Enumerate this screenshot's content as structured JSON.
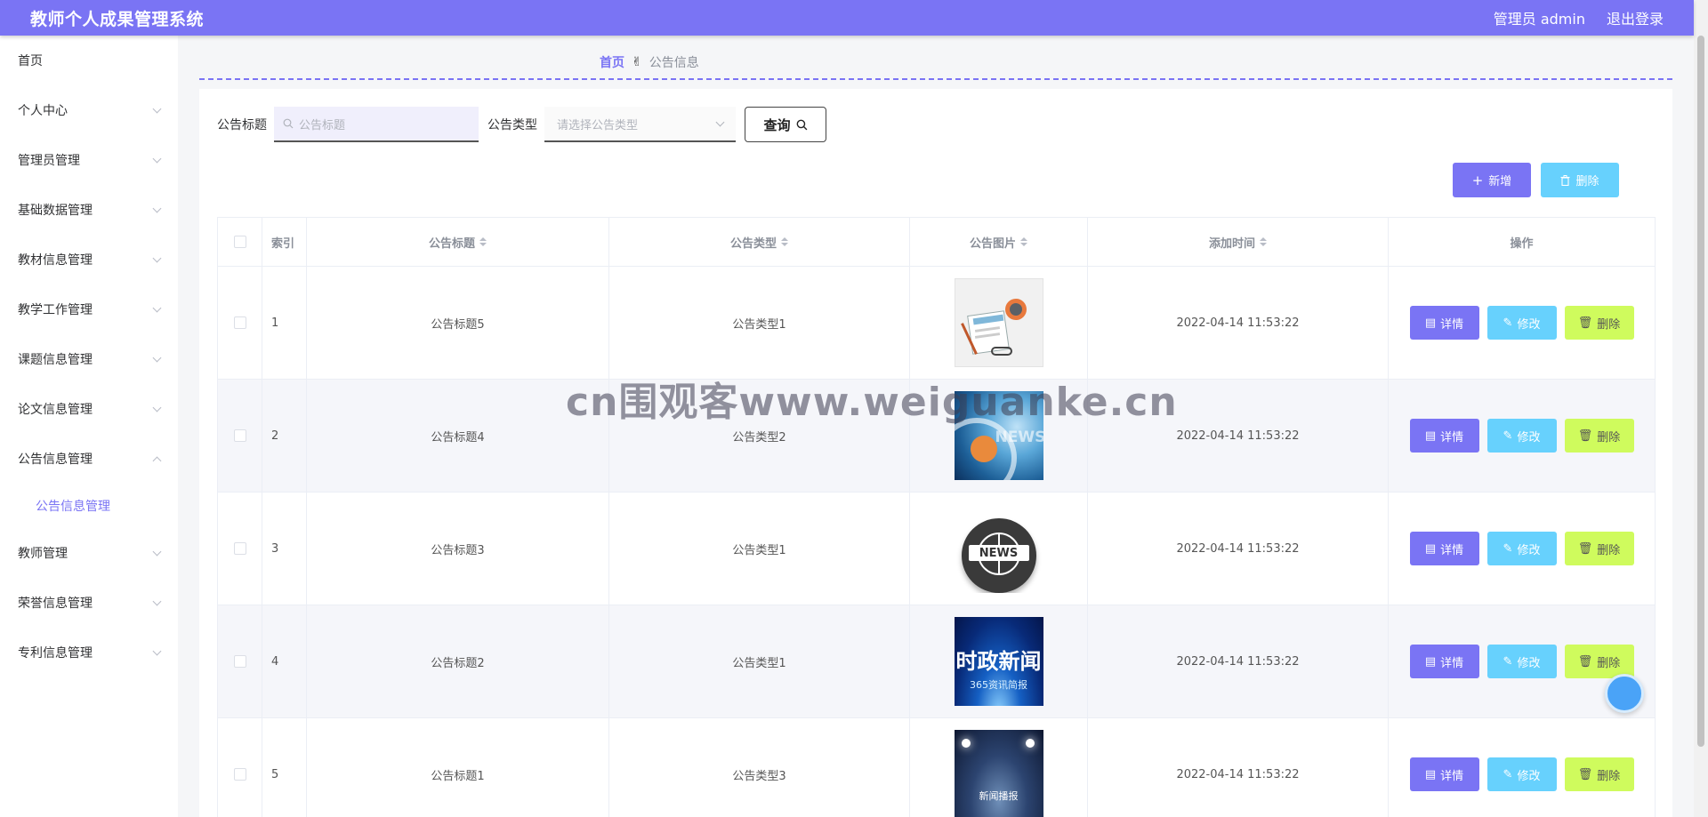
{
  "app": {
    "title": "教师个人成果管理系统"
  },
  "topbar": {
    "admin_label": "管理员 admin",
    "logout_label": "退出登录"
  },
  "sidebar": {
    "items": [
      {
        "label": "首页"
      },
      {
        "label": "个人中心"
      },
      {
        "label": "管理员管理"
      },
      {
        "label": "基础数据管理"
      },
      {
        "label": "教材信息管理"
      },
      {
        "label": "教学工作管理"
      },
      {
        "label": "课题信息管理"
      },
      {
        "label": "论文信息管理"
      },
      {
        "label": "公告信息管理"
      },
      {
        "label": "教师管理"
      },
      {
        "label": "荣誉信息管理"
      },
      {
        "label": "专利信息管理"
      }
    ],
    "active_sub": "公告信息管理"
  },
  "breadcrumb": {
    "home": "首页",
    "current": "公告信息"
  },
  "search": {
    "title_label": "公告标题",
    "title_placeholder": "公告标题",
    "type_label": "公告类型",
    "type_placeholder": "请选择公告类型",
    "query_label": "查询"
  },
  "actions": {
    "add_label": "新增",
    "delete_label": "删除"
  },
  "table": {
    "headers": {
      "index": "索引",
      "title": "公告标题",
      "type": "公告类型",
      "image": "公告图片",
      "time": "添加时间",
      "ops": "操作"
    },
    "ops": {
      "detail": "详情",
      "edit": "修改",
      "delete": "删除"
    },
    "rows": [
      {
        "index": "1",
        "title": "公告标题5",
        "type": "公告类型1",
        "time": "2022-04-14 11:53:22",
        "image": "news-illustration"
      },
      {
        "index": "2",
        "title": "公告标题4",
        "type": "公告类型2",
        "time": "2022-04-14 11:53:22",
        "image": "news-blue-globe"
      },
      {
        "index": "3",
        "title": "公告标题3",
        "type": "公告类型1",
        "time": "2022-04-14 11:53:22",
        "image": "news-globe-badge",
        "badge": "NEWS"
      },
      {
        "index": "4",
        "title": "公告标题2",
        "type": "公告类型1",
        "time": "2022-04-14 11:53:22",
        "image": "political-news-banner",
        "banner_title": "时政新闻",
        "banner_sub": "365资讯简报"
      },
      {
        "index": "5",
        "title": "公告标题1",
        "type": "公告类型3",
        "time": "2022-04-14 11:53:22",
        "image": "news-stage-spotlight",
        "stage_text": "新闻播报"
      }
    ]
  },
  "watermark": "cn围观客www.weiguanke.cn",
  "colors": {
    "primary": "#7a74f4",
    "info": "#67d1fd",
    "lime": "#cffb5d"
  }
}
